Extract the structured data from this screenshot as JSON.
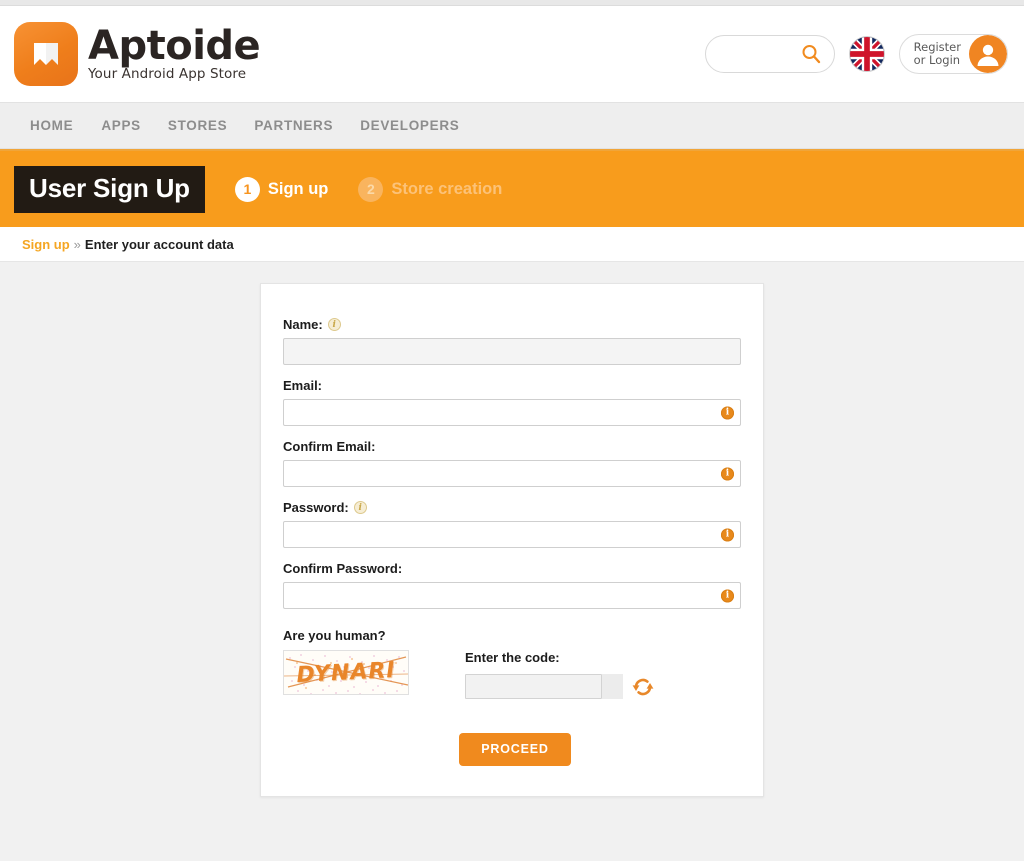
{
  "header": {
    "brand_name": "Aptoide",
    "brand_tagline": "Your Android App Store",
    "logo_icon": "aptoide-shield-icon",
    "search": {
      "value": "",
      "placeholder": "",
      "icon": "search-icon"
    },
    "language": {
      "flag": "uk-flag-icon",
      "label": "English"
    },
    "login": {
      "line1": "Register",
      "line2": "or Login",
      "icon": "user-avatar-icon"
    }
  },
  "nav": {
    "items": [
      {
        "label": "HOME"
      },
      {
        "label": "APPS"
      },
      {
        "label": "STORES"
      },
      {
        "label": "PARTNERS"
      },
      {
        "label": "DEVELOPERS"
      }
    ]
  },
  "banner": {
    "title": "User Sign Up",
    "steps": [
      {
        "num": "1",
        "label": "Sign up",
        "state": "active"
      },
      {
        "num": "2",
        "label": "Store creation",
        "state": "inactive"
      }
    ]
  },
  "breadcrumb": {
    "link": "Sign up",
    "separator": "»",
    "current": "Enter your account data"
  },
  "form": {
    "fields": [
      {
        "label": "Name:",
        "value": "",
        "placeholder": "",
        "has_label_info": true,
        "has_input_info": false,
        "style": "gray",
        "input_type": "text",
        "name": "name"
      },
      {
        "label": "Email:",
        "value": "",
        "placeholder": "",
        "has_label_info": false,
        "has_input_info": true,
        "style": "white",
        "input_type": "text",
        "name": "email"
      },
      {
        "label": "Confirm Email:",
        "value": "",
        "placeholder": "",
        "has_label_info": false,
        "has_input_info": true,
        "style": "white",
        "input_type": "text",
        "name": "confirm-email"
      },
      {
        "label": "Password:",
        "value": "",
        "placeholder": "",
        "has_label_info": true,
        "has_input_info": true,
        "style": "white",
        "input_type": "password",
        "name": "password"
      },
      {
        "label": "Confirm Password:",
        "value": "",
        "placeholder": "",
        "has_label_info": false,
        "has_input_info": true,
        "style": "white",
        "input_type": "password",
        "name": "confirm-password"
      }
    ],
    "captcha": {
      "question": "Are you human?",
      "image_text": "DYNARI",
      "code_label": "Enter the code:",
      "code_value": "",
      "code_placeholder": "",
      "refresh_icon": "refresh-icon"
    },
    "submit_label": "PROCEED"
  },
  "colors": {
    "brand_orange": "#f89c1c",
    "button_orange": "#f08a1e",
    "banner_dark": "#221b14",
    "page_bg": "#f1f1f1",
    "link_orange": "#f5a623",
    "info_orange": "#e8891b",
    "captcha_orange": "#e9862a"
  }
}
